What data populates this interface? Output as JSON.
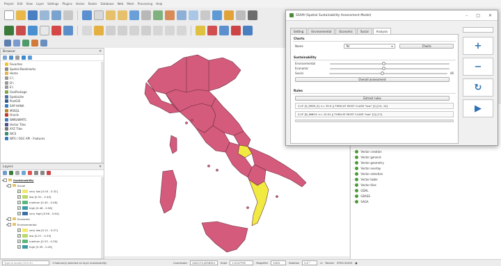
{
  "menubar": {
    "items": [
      "Project",
      "Edit",
      "View",
      "Layer",
      "Settings",
      "Plugins",
      "Vector",
      "Raster",
      "Database",
      "Web",
      "Mesh",
      "Processing",
      "Help"
    ]
  },
  "browser": {
    "title": "Browser",
    "items": [
      {
        "label": "Favorites",
        "icon": "star-icon",
        "color": "#f1c232"
      },
      {
        "label": "Spatial Bookmarks",
        "icon": "bookmark-icon",
        "color": "#888888"
      },
      {
        "label": "Home",
        "icon": "home-folder-icon",
        "color": "#e2b64d"
      },
      {
        "label": "C:\\",
        "icon": "drive-icon",
        "color": "#999999"
      },
      {
        "label": "D:\\",
        "icon": "drive-icon",
        "color": "#999999"
      },
      {
        "label": "E:\\",
        "icon": "drive-icon",
        "color": "#999999"
      },
      {
        "label": "GeoPackage",
        "icon": "geopackage-icon",
        "color": "#7fa84a"
      },
      {
        "label": "SpatiaLite",
        "icon": "spatialite-icon",
        "color": "#4a6fa5"
      },
      {
        "label": "PostGIS",
        "icon": "postgis-icon",
        "color": "#335c8a"
      },
      {
        "label": "SAP HANA",
        "icon": "database-icon",
        "color": "#2f7fc0"
      },
      {
        "label": "MSSQL",
        "icon": "database-icon",
        "color": "#b9882a"
      },
      {
        "label": "Oracle",
        "icon": "database-icon",
        "color": "#c0392b"
      },
      {
        "label": "WMS/WMTS",
        "icon": "globe-icon",
        "color": "#3f7fb7"
      },
      {
        "label": "Vector Tiles",
        "icon": "grid-icon",
        "color": "#4f4f8f"
      },
      {
        "label": "XYZ Tiles",
        "icon": "tiles-icon",
        "color": "#777777"
      },
      {
        "label": "WCS",
        "icon": "globe-icon",
        "color": "#3a8e6a"
      },
      {
        "label": "WFS / OGC API - Features",
        "icon": "globe-icon",
        "color": "#3a7ab8"
      }
    ]
  },
  "layers": {
    "title": "Layers",
    "groups": [
      {
        "label": "Sustainability",
        "bold": true,
        "underline": true
      },
      {
        "label": "Social",
        "items": [
          {
            "label": "very low [0.04 - 0.32]",
            "color": "#f2e871"
          },
          {
            "label": "low [0.32 - 0.40]",
            "color": "#b8d96a"
          },
          {
            "label": "medium [0.40 - 0.48]",
            "color": "#5cb87a"
          },
          {
            "label": "high [0.48 - 0.56]",
            "color": "#3a9ba6"
          },
          {
            "label": "very high [0.56 - 0.64]",
            "color": "#3d6ea8"
          }
        ]
      },
      {
        "label": "Economic"
      },
      {
        "label": "Environmental",
        "items": [
          {
            "label": "very low [0.21 - 0.27]",
            "color": "#f2e871"
          },
          {
            "label": "low [0.27 - 0.33]",
            "color": "#b8d96a"
          },
          {
            "label": "medium [0.33 - 0.39]",
            "color": "#5cb87a"
          },
          {
            "label": "high [0.39 - 0.45]",
            "color": "#3a9ba6"
          }
        ]
      }
    ]
  },
  "dialog": {
    "title": "SSAM (Spatial Sustainability Assessment Model)",
    "tabs": [
      "Setting",
      "Environmental",
      "Economic",
      "Social",
      "Analysis"
    ],
    "active_tab": "Analysis",
    "charts": {
      "header": "Charts",
      "name_label": "Name",
      "name_value": "Nc",
      "charts_button": "Charts"
    },
    "sustainability": {
      "header": "Sustainability",
      "environmental": "Environmental",
      "economic": "Economic",
      "social": "Social",
      "value": "46",
      "overall_button": "Overall assessment",
      "levels": {
        "environmental": 0.45,
        "economic": 0.45,
        "social": 0.45
      }
    },
    "rules": {
      "header": "Rules",
      "extract_button": "Extract rules",
      "items": [
        "1) IF [S_SRES_S] <= 35.9 || THEN AT MOST CLASS \"low\" [2] [10, 14]",
        "2) IF [B_INNOV <= 15.01 || THEN AT MOST CLASS \"low\" [2] [17]"
      ]
    },
    "side_buttons": [
      {
        "name": "add-button",
        "glyph": "+",
        "color": "#2f6fb3"
      },
      {
        "name": "remove-button",
        "glyph": "−",
        "color": "#2f6fb3"
      },
      {
        "name": "refresh-button",
        "glyph": "↻",
        "color": "#2f6fb3"
      },
      {
        "name": "run-button",
        "glyph": "▶",
        "color": "#2f6fb3"
      }
    ]
  },
  "processing": {
    "items": [
      "Vector creation",
      "Vector general",
      "Vector geometry",
      "Vector overlay",
      "Vector selection",
      "Vector table",
      "Vector tiles",
      "GDAL",
      "GRASS",
      "SAGA"
    ]
  },
  "statusbar": {
    "search_placeholder": "Type to locate (Ctrl+K)",
    "message": "1 feature(s) selected on layer sustainability",
    "coord_label": "Coordinate",
    "coord_value": "1262173,4938354",
    "scale_label": "Scale",
    "scale_value": "1:5147795",
    "magnifier_label": "Magnifier",
    "magnifier_value": "100%",
    "rotation_label": "Rotation",
    "rotation_value": "0.0 °",
    "render_label": "Render",
    "crs": "EPSG:32633"
  },
  "map": {
    "fill": "#d45b7c",
    "highlight": "#f1ea40"
  }
}
